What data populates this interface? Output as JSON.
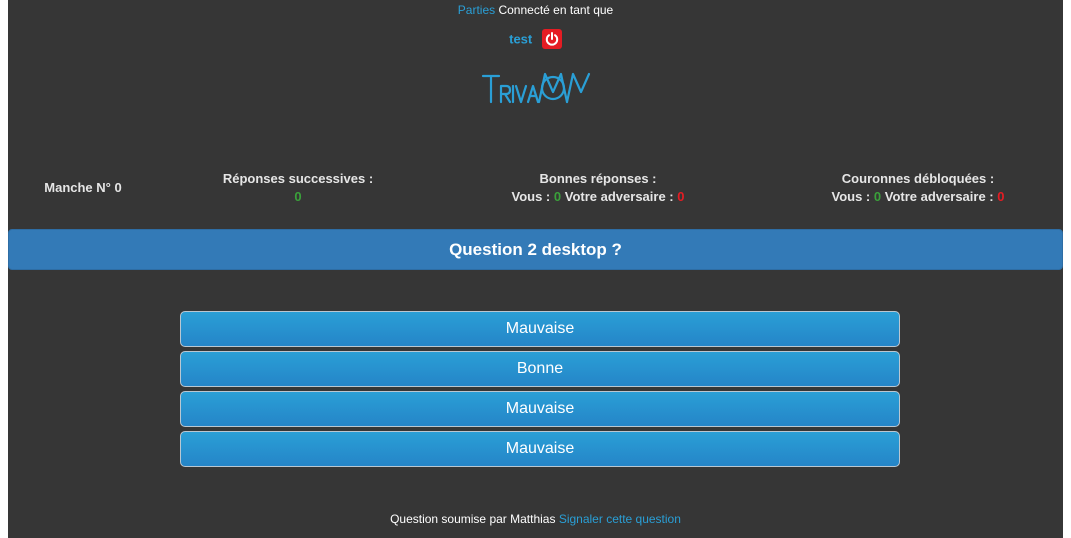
{
  "header": {
    "games_link": "Parties",
    "connected_text": "Connecté en tant que",
    "username": "test"
  },
  "stats": {
    "round_label": "Manche N° 0",
    "streak_label": "Réponses successives :",
    "streak_value": "0",
    "correct_label": "Bonnes réponses :",
    "correct_you_label": "Vous :",
    "correct_you_value": "0",
    "correct_opponent_label": "Votre adversaire :",
    "correct_opponent_value": "0",
    "crowns_label": "Couronnes débloquées :",
    "crowns_you_label": "Vous :",
    "crowns_you_value": "0",
    "crowns_opponent_label": "Votre adversaire :",
    "crowns_opponent_value": "0"
  },
  "question": {
    "text": "Question 2 desktop ?",
    "answers": [
      "Mauvaise",
      "Bonne",
      "Mauvaise",
      "Mauvaise"
    ]
  },
  "footer": {
    "submitted_by": "Question soumise par Matthias",
    "report_link": "Signaler cette question"
  },
  "colors": {
    "background": "#363636",
    "link": "#2a9fd6",
    "question_bar": "#337ab7",
    "answer_button": "#2a9fd6",
    "positive": "#3aa13a",
    "negative": "#e51c23"
  }
}
